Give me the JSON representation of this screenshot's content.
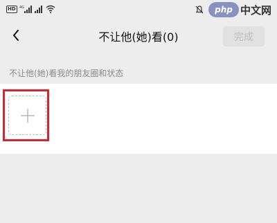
{
  "status_bar": {
    "badges": [
      "HD",
      "4G"
    ],
    "icons": [
      "hd-badge",
      "signal-4g-icon",
      "signal-icon",
      "wifi-icon",
      "do-not-disturb-icon"
    ]
  },
  "watermark": {
    "logo": "php",
    "text": "中文网"
  },
  "nav": {
    "title": "不让他(她)看(0)",
    "done_label": "完成",
    "back_icon": "chevron-left-icon"
  },
  "section": {
    "label": "不让他(她)看我的朋友圈和状态"
  },
  "add_member": {
    "icon": "plus-icon"
  },
  "colors": {
    "background": "#ededed",
    "panel": "#ffffff",
    "highlight": "#d9232d",
    "done_disabled_bg": "#e1e1e1"
  }
}
